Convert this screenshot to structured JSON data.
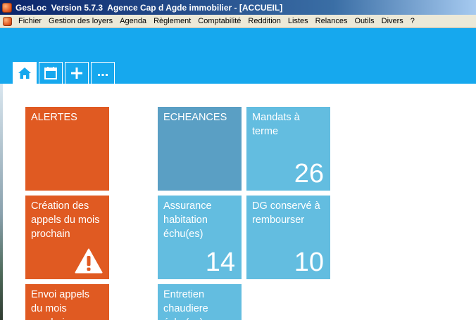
{
  "window": {
    "title": "GesLoc  Version 5.7.3  Agence Cap d Agde immobilier - [ACCUEIL]",
    "app_icon": "gesloc-app-icon"
  },
  "menu": {
    "items": [
      "Fichier",
      "Gestion des loyers",
      "Agenda",
      "Règlement",
      "Comptabilité",
      "Reddition",
      "Listes",
      "Relances",
      "Outils",
      "Divers",
      "?"
    ]
  },
  "tabs": [
    {
      "icon": "home-icon",
      "active": true
    },
    {
      "icon": "calendar-icon",
      "active": false
    },
    {
      "icon": "plus-icon",
      "active": false
    },
    {
      "icon": "more-icon",
      "active": false
    }
  ],
  "tiles": {
    "alertes": {
      "label": "ALERTES"
    },
    "creation_appels": {
      "label": "Création des appels du mois prochain",
      "icon": "warning-icon"
    },
    "envoi_appels": {
      "label": "Envoi appels du mois prochain"
    },
    "echeances": {
      "label": "ECHEANCES"
    },
    "mandats": {
      "label": "Mandats à terme",
      "count": "26"
    },
    "assurance": {
      "label": "Assurance habitation échu(es)",
      "count": "14"
    },
    "dg": {
      "label": "DG conservé à rembourser",
      "count": "10"
    },
    "entretien": {
      "label": "Entretien chaudiere échu(es)"
    }
  },
  "colors": {
    "banner": "#16a8ee",
    "tile_orange": "#e05a22",
    "tile_steel": "#5a9fc4",
    "tile_sky": "#63bde0"
  }
}
